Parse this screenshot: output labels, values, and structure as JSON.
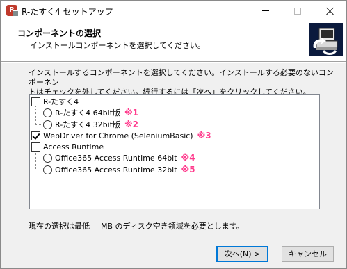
{
  "window": {
    "title": "R-たすく4 セットアップ",
    "icon": "app-installer-icon",
    "icon_letter": "R",
    "controls": {
      "minimize": "minimize-icon",
      "maximize": "maximize-icon",
      "close": "close-icon"
    }
  },
  "header": {
    "title": "コンポーネントの選択",
    "subtitle": "インストールコンポーネントを選択してください。",
    "graphic": "computer-install-icon"
  },
  "instructions": {
    "line1": "インストールするコンポーネントを選択してください。インストールする必要のないコンポーネン",
    "line2": "トはチェックを外してください。続行するには「次へ」をクリックしてください。"
  },
  "components": [
    {
      "type": "checkbox",
      "level": 0,
      "label": "R-たすく4",
      "checked": false,
      "annotation": ""
    },
    {
      "type": "radio",
      "level": 1,
      "label": "R-たすく4  64bit版",
      "checked": false,
      "annotation": "※1"
    },
    {
      "type": "radio",
      "level": 1,
      "label": "R-たすく4  32bit版",
      "checked": false,
      "annotation": "※2"
    },
    {
      "type": "checkbox",
      "level": 0,
      "label": "WebDriver for Chrome (SeleniumBasic)",
      "checked": true,
      "annotation": "※3"
    },
    {
      "type": "checkbox",
      "level": 0,
      "label": "Access Runtime",
      "checked": false,
      "annotation": ""
    },
    {
      "type": "radio",
      "level": 1,
      "label": "Office365 Access Runtime 64bit",
      "checked": false,
      "annotation": "※4"
    },
    {
      "type": "radio",
      "level": 1,
      "label": "Office365 Access Runtime 32bit",
      "checked": false,
      "annotation": "※5"
    }
  ],
  "space_note": {
    "prefix": "現在の選択は最低",
    "suffix": "MB のディスク空き領域を必要とします。"
  },
  "buttons": {
    "next": "次へ(N) >",
    "cancel": "キャンセル"
  },
  "colors": {
    "annotation": "#ff3a8c",
    "header_graphic_bg": "#0b1a3d",
    "default_button_border": "#0078d7"
  }
}
